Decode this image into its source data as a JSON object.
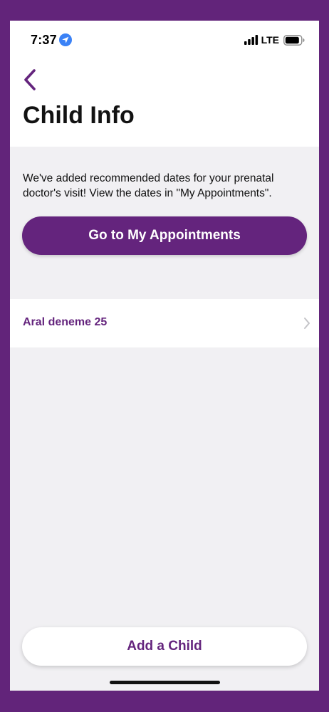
{
  "status_bar": {
    "time": "7:37",
    "network": "LTE",
    "icons": [
      "location-arrow-icon",
      "signal-bars-icon",
      "battery-icon"
    ]
  },
  "header": {
    "back_icon": "chevron-left-icon",
    "title": "Child Info"
  },
  "notice": {
    "text": "We've added recommended dates for your prenatal doctor's visit! View the dates in \"My Appointments\"."
  },
  "appointments_button": {
    "label": "Go to My Appointments"
  },
  "children": [
    {
      "name": "Aral deneme 25",
      "icon": "chevron-right-icon"
    }
  ],
  "add_child_button": {
    "label": "Add a Child"
  },
  "colors": {
    "brand_purple": "#64247d",
    "frame_purple": "#62247a",
    "background": "#f1f0f3",
    "location_blue": "#3b82f6"
  }
}
